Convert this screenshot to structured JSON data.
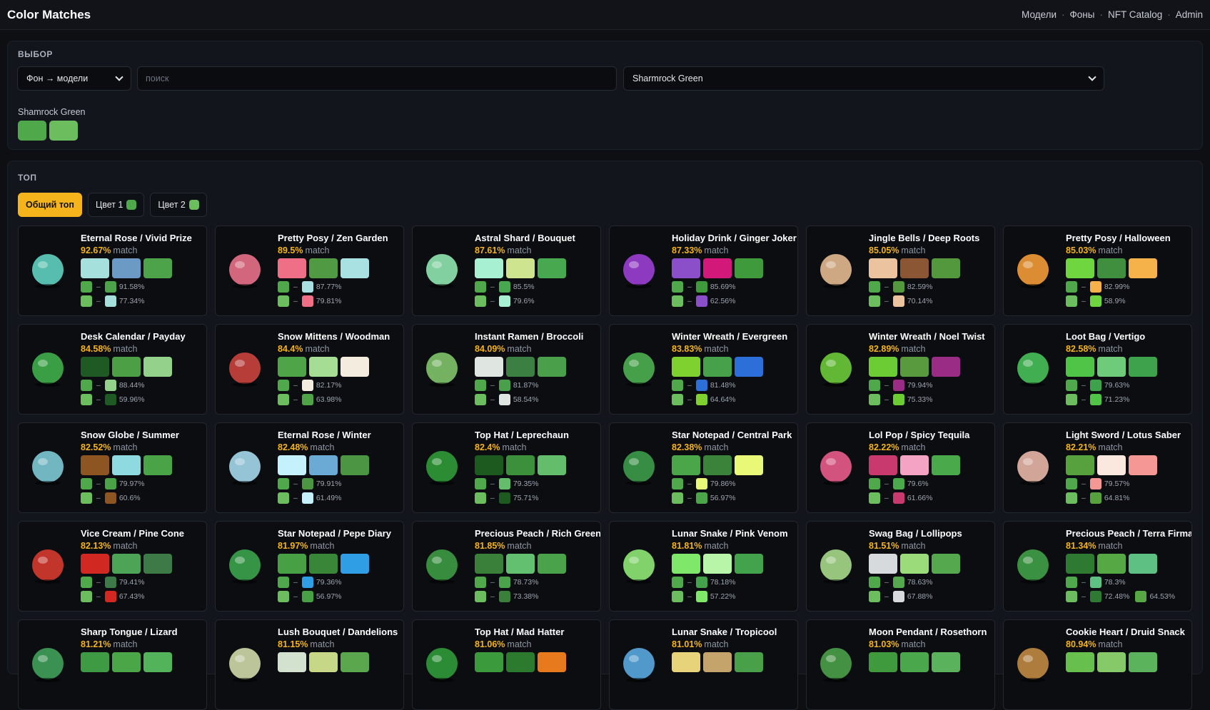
{
  "header": {
    "title": "Color Matches",
    "nav": [
      "Модели",
      "Фоны",
      "NFT Catalog",
      "Admin"
    ]
  },
  "select_panel": {
    "title": "ВЫБОР",
    "mode_value": "Фон → модели",
    "search_placeholder": "поиск",
    "background_value": "Sharmrock Green",
    "bg_label": "Shamrock Green",
    "bg_colors": [
      "#4fa84a",
      "#6bbd5e"
    ]
  },
  "top_panel": {
    "title": "ТОП",
    "tabs": [
      {
        "label": "Общий топ",
        "dot": null
      },
      {
        "label": "Цвет 1",
        "dot": "#4fa84a"
      },
      {
        "label": "Цвет 2",
        "dot": "#6bbd5e"
      }
    ]
  },
  "cards": [
    {
      "name": "Eternal Rose / Vivid Prize",
      "pct": "92.67%",
      "colors": [
        "#a6e0dc",
        "#6b9bc4",
        "#4ca34a"
      ],
      "m1": "91.58%",
      "m2": "77.34%",
      "icon": "trophy-icon",
      "iconColor": "#5fd0c0"
    },
    {
      "name": "Pretty Posy / Zen Garden",
      "pct": "89.5%",
      "colors": [
        "#ef6f86",
        "#4f9a42",
        "#a9e0e2"
      ],
      "m1": "87.77%",
      "m2": "79.81%",
      "icon": "bouquet-icon",
      "iconColor": "#e8708a"
    },
    {
      "name": "Astral Shard / Bouquet",
      "pct": "87.61%",
      "colors": [
        "#a7f0d2",
        "#cfe48e",
        "#47a84f"
      ],
      "m1": "85.5%",
      "m2": "79.6%",
      "icon": "crystal-icon",
      "iconColor": "#8fe6b0"
    },
    {
      "name": "Holiday Drink / Ginger Joker",
      "pct": "87.33%",
      "colors": [
        "#8a4fc9",
        "#d2197a",
        "#3f9a3b"
      ],
      "m1": "85.69%",
      "m2": "62.56%",
      "icon": "drink-icon",
      "iconColor": "#9b3fd4"
    },
    {
      "name": "Jingle Bells / Deep Roots",
      "pct": "85.05%",
      "colors": [
        "#ebc49f",
        "#8a5634",
        "#54983e"
      ],
      "m1": "82.59%",
      "m2": "70.14%",
      "icon": "bells-icon",
      "iconColor": "#e3b990"
    },
    {
      "name": "Pretty Posy / Halloween",
      "pct": "85.03%",
      "colors": [
        "#6fd63f",
        "#3f8f3f",
        "#f6b24a"
      ],
      "m1": "82.99%",
      "m2": "58.9%",
      "icon": "bouquet-icon",
      "iconColor": "#f39b38"
    },
    {
      "name": "Desk Calendar / Payday",
      "pct": "84.58%",
      "colors": [
        "#1f5a24",
        "#4c9f44",
        "#94d18a"
      ],
      "m1": "88.44%",
      "m2": "59.96%",
      "icon": "calendar-icon",
      "iconColor": "#3fae4a"
    },
    {
      "name": "Snow Mittens / Woodman",
      "pct": "84.4%",
      "colors": [
        "#4ea447",
        "#a6dd95",
        "#f5ece0"
      ],
      "m1": "82.17%",
      "m2": "63.98%",
      "icon": "mittens-icon",
      "iconColor": "#c9423d"
    },
    {
      "name": "Instant Ramen / Broccoli",
      "pct": "84.09%",
      "colors": [
        "#dfe5e1",
        "#3b7f42",
        "#4aa04a"
      ],
      "m1": "81.87%",
      "m2": "58.54%",
      "icon": "ramen-icon",
      "iconColor": "#7fc46a"
    },
    {
      "name": "Winter Wreath / Evergreen",
      "pct": "83.83%",
      "colors": [
        "#7ed12f",
        "#47a14a",
        "#2d6fd8"
      ],
      "m1": "81.48%",
      "m2": "64.64%",
      "icon": "wreath-icon",
      "iconColor": "#4caf50"
    },
    {
      "name": "Winter Wreath / Noel Twist",
      "pct": "82.89%",
      "colors": [
        "#6bcc33",
        "#5a9a3e",
        "#9a2c86"
      ],
      "m1": "79.94%",
      "m2": "75.33%",
      "icon": "wreath-icon",
      "iconColor": "#6ccb3a"
    },
    {
      "name": "Loot Bag / Vertigo",
      "pct": "82.58%",
      "colors": [
        "#50c447",
        "#6dcb79",
        "#3da24b"
      ],
      "m1": "79.63%",
      "m2": "71.23%",
      "icon": "bag-icon",
      "iconColor": "#48c05a"
    },
    {
      "name": "Snow Globe / Summer",
      "pct": "82.52%",
      "colors": [
        "#8c5522",
        "#8fd9e0",
        "#4aa447"
      ],
      "m1": "79.97%",
      "m2": "60.6%",
      "icon": "globe-icon",
      "iconColor": "#7dc9d6"
    },
    {
      "name": "Eternal Rose / Winter",
      "pct": "82.48%",
      "colors": [
        "#c4f1fb",
        "#6aaad5",
        "#4c9543"
      ],
      "m1": "79.91%",
      "m2": "61.49%",
      "icon": "trophy-icon",
      "iconColor": "#a3d8ec"
    },
    {
      "name": "Top Hat / Leprechaun",
      "pct": "82.4%",
      "colors": [
        "#1c5a1f",
        "#3c8f3b",
        "#63bd6b"
      ],
      "m1": "79.35%",
      "m2": "75.71%",
      "icon": "hat-icon",
      "iconColor": "#2f9a38"
    },
    {
      "name": "Star Notepad / Central Park",
      "pct": "82.38%",
      "colors": [
        "#4aa648",
        "#3b833b",
        "#eaf877"
      ],
      "m1": "79.86%",
      "m2": "56.97%",
      "icon": "notepad-icon",
      "iconColor": "#3d9b4a"
    },
    {
      "name": "Lol Pop / Spicy Tequila",
      "pct": "82.22%",
      "colors": [
        "#c83a6e",
        "#f5a3c5",
        "#4aa94b"
      ],
      "m1": "79.6%",
      "m2": "61.66%",
      "icon": "lollipop-icon",
      "iconColor": "#e95b8c"
    },
    {
      "name": "Light Sword / Lotus Saber",
      "pct": "82.21%",
      "colors": [
        "#58a13f",
        "#fae7de",
        "#f59895"
      ],
      "m1": "79.57%",
      "m2": "64.81%",
      "icon": "sword-icon",
      "iconColor": "#e8b6a8"
    },
    {
      "name": "Vice Cream / Pine Cone",
      "pct": "82.13%",
      "colors": [
        "#d12921",
        "#4ea456",
        "#3d7a47"
      ],
      "m1": "79.41%",
      "m2": "67.43%",
      "icon": "icecream-icon",
      "iconColor": "#d63a2f"
    },
    {
      "name": "Star Notepad / Pepe Diary",
      "pct": "81.97%",
      "colors": [
        "#48a045",
        "#3a8639",
        "#2f9ee4"
      ],
      "m1": "79.36%",
      "m2": "56.97%",
      "icon": "notepad-icon",
      "iconColor": "#3aa34c"
    },
    {
      "name": "Precious Peach / Rich Green",
      "pct": "81.85%",
      "colors": [
        "#3a7f3a",
        "#64c071",
        "#4aa34a"
      ],
      "m1": "78.73%",
      "m2": "73.38%",
      "icon": "peach-icon",
      "iconColor": "#3c9a42"
    },
    {
      "name": "Lunar Snake / Pink Venom",
      "pct": "81.81%",
      "colors": [
        "#7fe86a",
        "#b9f5a8",
        "#43a34c"
      ],
      "m1": "78.18%",
      "m2": "57.22%",
      "icon": "snake-icon",
      "iconColor": "#8ee876"
    },
    {
      "name": "Swag Bag / Lollipops",
      "pct": "81.51%",
      "colors": [
        "#d6dadc",
        "#9bdb79",
        "#56a84f"
      ],
      "m1": "78.63%",
      "m2": "67.88%",
      "icon": "bag-icon",
      "iconColor": "#a7d98a"
    },
    {
      "name": "Precious Peach / Terra Firma",
      "pct": "81.34%",
      "colors": [
        "#2f7a33",
        "#55a844",
        "#5ec083"
      ],
      "m1": "78.3%",
      "m2": "72.48%",
      "m3": "64.53%",
      "icon": "peach-icon",
      "iconColor": "#40a048"
    },
    {
      "name": "Sharp Tongue / Lizard",
      "pct": "81.21%",
      "colors": [
        "#3e9a43",
        "#4aa646",
        "#53b35a"
      ],
      "m1": "",
      "m2": "",
      "icon": "lizard-icon",
      "iconColor": "#3fa05a"
    },
    {
      "name": "Lush Bouquet / Dandelions",
      "pct": "81.15%",
      "colors": [
        "#d2e2cf",
        "#c6d887",
        "#5aa74e"
      ],
      "m1": "",
      "m2": "",
      "icon": "bouquet-icon",
      "iconColor": "#cfd9a8"
    },
    {
      "name": "Top Hat / Mad Hatter",
      "pct": "81.06%",
      "colors": [
        "#3b9a3b",
        "#2c7a2d",
        "#e87a1e"
      ],
      "m1": "",
      "m2": "",
      "icon": "hat-icon",
      "iconColor": "#2f9a3a"
    },
    {
      "name": "Lunar Snake / Tropicool",
      "pct": "81.01%",
      "colors": [
        "#e7d37a",
        "#c4a46a",
        "#48a149"
      ],
      "m1": "",
      "m2": "",
      "icon": "snake-icon",
      "iconColor": "#5aa8e0"
    },
    {
      "name": "Moon Pendant / Rosethorn",
      "pct": "81.03%",
      "colors": [
        "#3f9a3d",
        "#4aa74b",
        "#5ab35c"
      ],
      "m1": "",
      "m2": "",
      "icon": "pendant-icon",
      "iconColor": "#4aa04a"
    },
    {
      "name": "Cookie Heart / Druid Snack",
      "pct": "80.94%",
      "colors": [
        "#67c04d",
        "#86c969",
        "#5bb45b"
      ],
      "m1": "",
      "m2": "",
      "icon": "cookie-icon",
      "iconColor": "#c08a43"
    }
  ],
  "match_word": "match"
}
